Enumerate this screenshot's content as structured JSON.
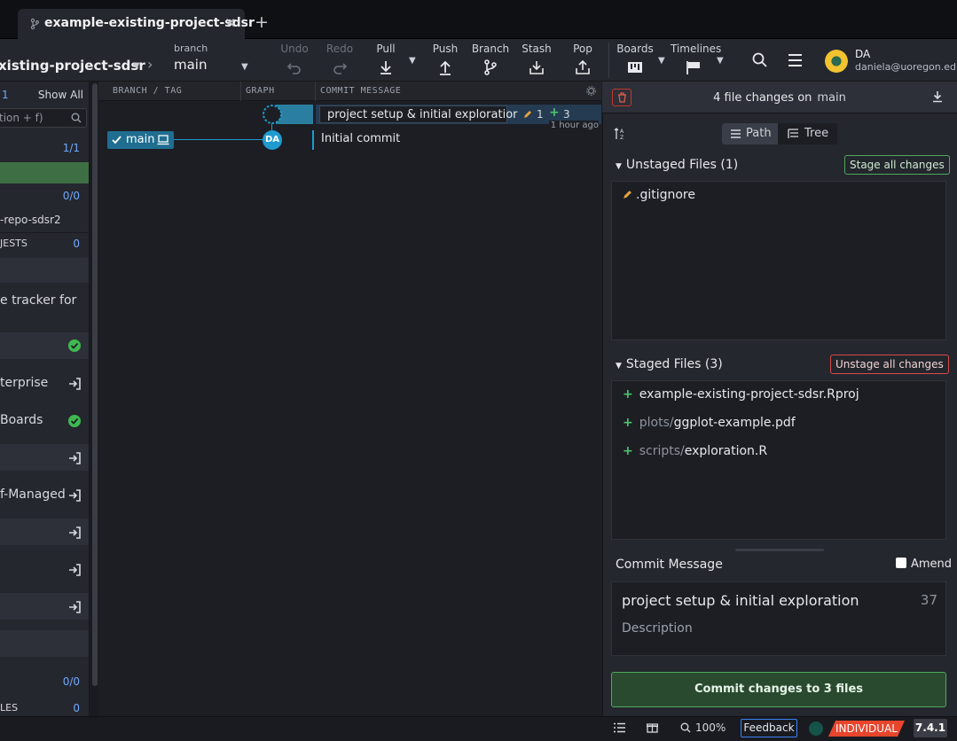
{
  "tab": {
    "title": "example-existing-project-sdsr",
    "close": "✕",
    "new": "+"
  },
  "toolbar": {
    "repo_name": "xisting-project-sdsr",
    "branch_label": "branch",
    "branch_value": "main",
    "undo": "Undo",
    "redo": "Redo",
    "pull": "Pull",
    "push": "Push",
    "branch": "Branch",
    "stash": "Stash",
    "pop": "Pop",
    "boards": "Boards",
    "timelines": "Timelines",
    "user_initials": "DA",
    "user_email": "daniela@uoregon.edu"
  },
  "left_panel": {
    "local_count": "1",
    "show_all": "Show All",
    "search_placeholder": "tion + f)",
    "branches_count": "1/1",
    "remote_count": "0/0",
    "remote_name": "-repo-sdsr2",
    "pull_requests": "JESTS",
    "pull_requests_count": "0",
    "issue_tracker": "e tracker for",
    "enterprise": "terprise",
    "boards": "Boards",
    "self_managed": "f-Managed",
    "tags_count": "0/0",
    "files_label": "LES",
    "files_count": "0"
  },
  "graph": {
    "col_branch": "BRANCH / TAG",
    "col_graph": "GRAPH",
    "col_message": "COMMIT MESSAGE",
    "wip_message": "project setup & initial exploratior",
    "wip_modified": "1",
    "wip_added": "3",
    "wip_time": "1 hour ago",
    "branch_name": "main",
    "avatar_initials": "DA",
    "commit_message": "Initial commit"
  },
  "right_panel": {
    "changes_title": "4 file changes on",
    "changes_branch": "main",
    "view_path": "Path",
    "view_tree": "Tree",
    "unstaged_title": "Unstaged Files (1)",
    "stage_all": "Stage all changes",
    "unstaged_files": [
      {
        "name": ".gitignore"
      }
    ],
    "staged_title": "Staged Files (3)",
    "unstage_all": "Unstage all changes",
    "staged_files": [
      {
        "dir": "",
        "name": "example-existing-project-sdsr.Rproj"
      },
      {
        "dir": "plots/",
        "name": "ggplot-example.pdf"
      },
      {
        "dir": "scripts/",
        "name": "exploration.R"
      }
    ],
    "commit_message_label": "Commit Message",
    "amend": "Amend",
    "summary": "project setup & initial exploration",
    "char_count": "37",
    "description_placeholder": "Description",
    "commit_button": "Commit changes to 3 files"
  },
  "statusbar": {
    "zoom": "100%",
    "feedback": "Feedback",
    "plan": "INDIVIDUAL",
    "version": "7.4.1"
  },
  "colors": {
    "accent_blue": "#1f9bcf",
    "added_green": "#4ec46a",
    "modified_orange": "#e8a33c",
    "plan_red": "#e8452c"
  }
}
